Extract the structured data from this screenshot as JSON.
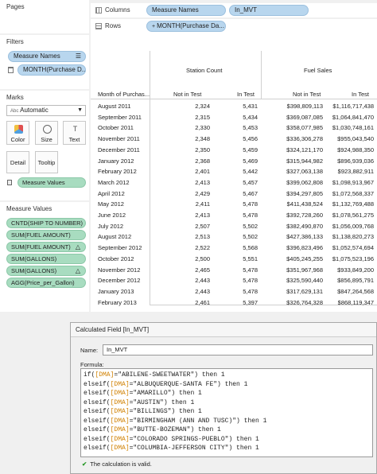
{
  "pages": {
    "title": "Pages"
  },
  "filters": {
    "title": "Filters",
    "items": [
      "Measure Names",
      "MONTH(Purchase D..."
    ]
  },
  "marks": {
    "title": "Marks",
    "type": "Automatic",
    "type_prefix": "Abc",
    "buttons": [
      "Color",
      "Size",
      "Text",
      "Detail",
      "Tooltip"
    ],
    "measure_values_pill": "Measure Values"
  },
  "measure_values": {
    "title": "Measure Values",
    "items": [
      "CNTD(SHIP TO NUMBER)",
      "SUM(FUEL AMOUNT)",
      "SUM(FUEL AMOUNT)",
      "SUM(GALLONS)",
      "SUM(GALLONS)",
      "AGG(Price_per_Gallon)"
    ]
  },
  "shelves": {
    "columns_label": "Columns",
    "columns_pills": [
      "Measure Names",
      "In_MVT"
    ],
    "rows_label": "Rows",
    "rows_pills": [
      "MONTH(Purchase Da..."
    ],
    "rows_prefix": "+"
  },
  "table": {
    "group_headers": [
      "Station Count",
      "Fuel Sales"
    ],
    "row_header": "Month of Purchas...",
    "col_headers": [
      "Not in Test",
      "In Test",
      "Not in Test",
      "In Test"
    ],
    "rows": [
      [
        "August 2011",
        "2,324",
        "5,431",
        "$398,809,113",
        "$1,116,717,438"
      ],
      [
        "September 2011",
        "2,315",
        "5,434",
        "$369,087,085",
        "$1,064,841,470"
      ],
      [
        "October 2011",
        "2,330",
        "5,453",
        "$358,077,985",
        "$1,030,748,161"
      ],
      [
        "November 2011",
        "2,348",
        "5,456",
        "$336,306,278",
        "$955,043,540"
      ],
      [
        "December 2011",
        "2,350",
        "5,459",
        "$324,121,170",
        "$924,988,350"
      ],
      [
        "January 2012",
        "2,368",
        "5,469",
        "$315,944,982",
        "$896,939,036"
      ],
      [
        "February 2012",
        "2,401",
        "5,442",
        "$327,063,138",
        "$923,882,911"
      ],
      [
        "March 2012",
        "2,413",
        "5,457",
        "$399,062,808",
        "$1,098,913,967"
      ],
      [
        "April 2012",
        "2,429",
        "5,467",
        "$394,297,805",
        "$1,072,568,337"
      ],
      [
        "May 2012",
        "2,411",
        "5,478",
        "$411,438,524",
        "$1,132,769,488"
      ],
      [
        "June 2012",
        "2,413",
        "5,478",
        "$392,728,260",
        "$1,078,561,275"
      ],
      [
        "July 2012",
        "2,507",
        "5,502",
        "$382,490,870",
        "$1,056,009,768"
      ],
      [
        "August 2012",
        "2,513",
        "5,502",
        "$427,386,133",
        "$1,138,820,273"
      ],
      [
        "September 2012",
        "2,522",
        "5,568",
        "$396,823,496",
        "$1,052,574,694"
      ],
      [
        "October 2012",
        "2,500",
        "5,551",
        "$405,245,255",
        "$1,075,523,196"
      ],
      [
        "November 2012",
        "2,465",
        "5,478",
        "$351,967,968",
        "$933,849,200"
      ],
      [
        "December 2012",
        "2,443",
        "5,478",
        "$325,590,440",
        "$856,895,791"
      ],
      [
        "January 2013",
        "2,443",
        "5,478",
        "$317,629,131",
        "$847,264,568"
      ],
      [
        "February 2013",
        "2,461",
        "5,397",
        "$326,764,328",
        "$868,119,347"
      ]
    ]
  },
  "dialog": {
    "title": "Calculated Field [In_MVT]",
    "name_label": "Name:",
    "name_value": "In_MVT",
    "formula_label": "Formula:",
    "lines": [
      {
        "pre": "if(",
        "field": "[DMA]",
        "post": "=\"ABILENE-SWEETWATER\") then 1"
      },
      {
        "pre": "elseif(",
        "field": "[DMA]",
        "post": "=\"ALBUQUERQUE-SANTA FE\") then 1"
      },
      {
        "pre": "elseif(",
        "field": "[DMA]",
        "post": "=\"AMARILLO\") then 1"
      },
      {
        "pre": "elseif(",
        "field": "[DMA]",
        "post": "=\"AUSTIN\") then 1"
      },
      {
        "pre": "elseif(",
        "field": "[DMA]",
        "post": "=\"BILLINGS\") then 1"
      },
      {
        "pre": "elseif(",
        "field": "[DMA]",
        "post": "=\"BIRMINGHAM (ANN AND TUSC)\") then 1"
      },
      {
        "pre": "elseif(",
        "field": "[DMA]",
        "post": "=\"BUTTE-BOZEMAN\") then 1"
      },
      {
        "pre": "elseif(",
        "field": "[DMA]",
        "post": "=\"COLORADO SPRINGS-PUEBLO\") then 1"
      },
      {
        "pre": "elseif(",
        "field": "[DMA]",
        "post": "=\"COLUMBIA-JEFFERSON CITY\") then 1"
      }
    ],
    "valid_text": "The calculation is valid.",
    "valid_icon": "check-icon"
  },
  "colors": {
    "pill_blue": "#b8d6ee",
    "pill_green": "#a8dcc0",
    "field_orange": "#d08000"
  }
}
